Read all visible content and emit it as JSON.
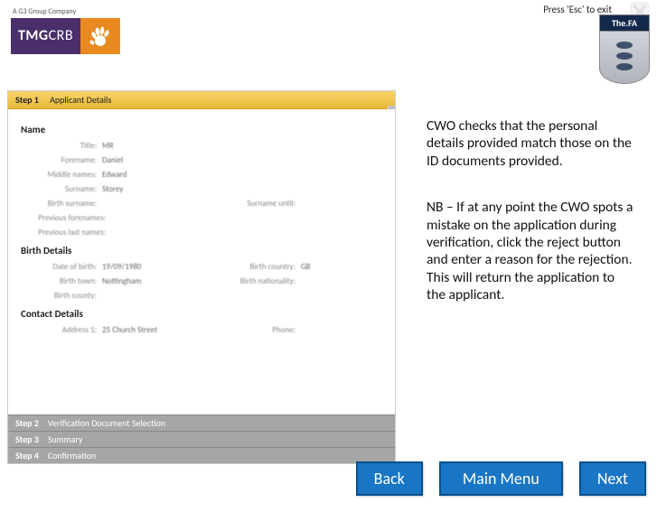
{
  "header": {
    "company_tag": "A G3 Group Company",
    "logo_tmg": "TMG",
    "logo_crb": "CRB",
    "esc_text": "Press 'Esc' to exit",
    "fa_label": "The.FA"
  },
  "form": {
    "step1": {
      "num": "Step 1",
      "title": "Applicant Details"
    },
    "step2": {
      "num": "Step 2",
      "title": "Verification Document Selection"
    },
    "step3": {
      "num": "Step 3",
      "title": "Summary"
    },
    "step4": {
      "num": "Step 4",
      "title": "Confirmation"
    },
    "name_section": "Name",
    "birth_section": "Birth Details",
    "contact_section": "Contact Details",
    "fields": {
      "title_l": "Title:",
      "title_v": "MR",
      "forename_l": "Forename:",
      "forename_v": "Daniel",
      "middle_l": "Middle names:",
      "middle_v": "Edward",
      "surname_l": "Surname:",
      "surname_v": "Storey",
      "birthsur_l": "Birth surname:",
      "surnameuntil_l": "Surname until:",
      "prevfore_l": "Previous forenames:",
      "prevlast_l": "Previous last names:",
      "dob_l": "Date of birth:",
      "dob_v": "19/09/1980",
      "birthcountry_l": "Birth country:",
      "birthcountry_v": "GB",
      "birthtown_l": "Birth town:",
      "birthtown_v": "Nottingham",
      "birthnat_l": "Birth nationality:",
      "birthcounty_l": "Birth county:",
      "address_l": "Address 1:",
      "address_v": "25 Church Street",
      "phone_l": "Phone:"
    }
  },
  "side": {
    "p1": "CWO checks that the personal details provided match those on the ID documents provided.",
    "p2": "NB – If at any point the CWO spots a mistake on the application during verification, click the reject button and enter a reason for the rejection. This will return the application to the applicant."
  },
  "nav": {
    "back": "Back",
    "menu": "Main Menu",
    "next": "Next"
  }
}
